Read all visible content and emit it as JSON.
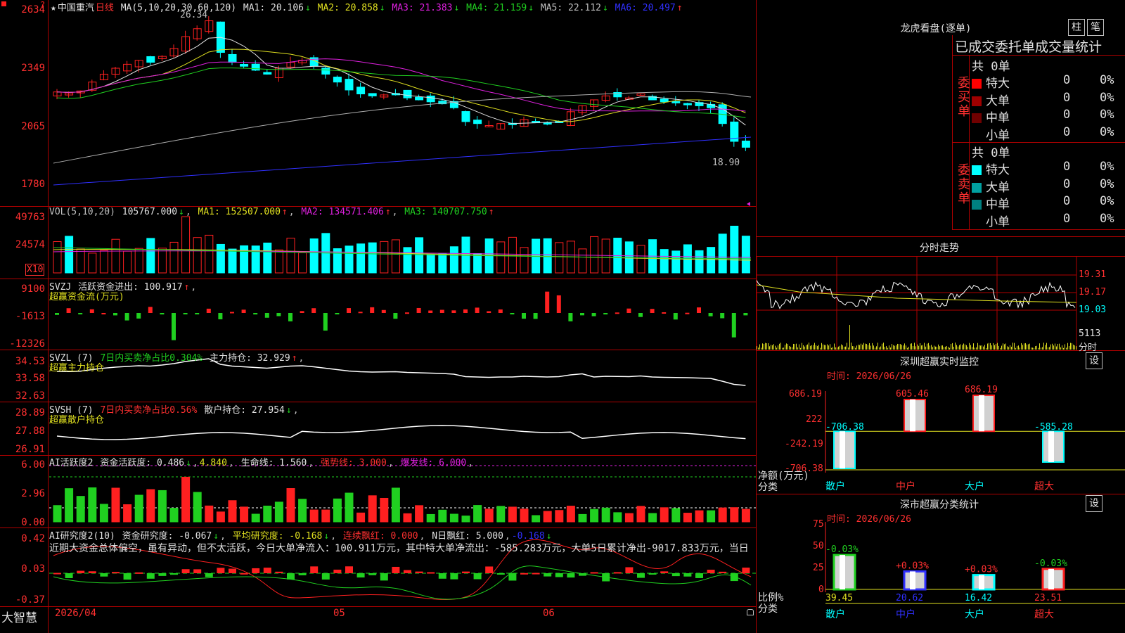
{
  "stock": {
    "star": "★",
    "name": "中国重汽",
    "period": "日线",
    "ma_label": "MA(5,10,20,30,60,120)",
    "ma": [
      {
        "label": "MA1: 20.106",
        "arrow": "↓",
        "color": "#e0e0e0"
      },
      {
        "label": "MA2: 20.858",
        "arrow": "↓",
        "color": "#e0e020"
      },
      {
        "label": "MA3: 21.383",
        "arrow": "↓",
        "color": "#e020e0"
      },
      {
        "label": "MA4: 21.159",
        "arrow": "↓",
        "color": "#20d020"
      },
      {
        "label": "MA5: 22.112",
        "arrow": "↓",
        "color": "#c0c0c0"
      },
      {
        "label": "MA6: 20.497",
        "arrow": "↑",
        "color": "#3030ff"
      }
    ],
    "high_mark": "26.34",
    "low_mark": "18.90",
    "y_labels": [
      "2634",
      "2349",
      "2065",
      "1780"
    ]
  },
  "vol": {
    "title": "VOL(5,10,20)",
    "value": "105767.000",
    "ma1": "MA1: 152507.000",
    "ma2": "MA2: 134571.406",
    "ma3": "MA3: 140707.750",
    "y_labels": [
      "49763",
      "24574"
    ],
    "unit": "X10"
  },
  "svzj": {
    "title": "SVZJ",
    "desc": "活跃资金进出: 100.917",
    "sub": "超赢资金流(万元)",
    "y_labels": [
      "9100",
      "-1613",
      "-12326"
    ]
  },
  "svzl": {
    "title": "SVZL (7)",
    "desc1": "7日内买卖净占比0.304%",
    "desc2": "主力持仓: 32.929",
    "sub": "超赢主力持仓",
    "y_labels": [
      "34.53",
      "33.58",
      "32.63"
    ]
  },
  "svsh": {
    "title": "SVSH (7)",
    "desc1": "7日内买卖净占比0.56%",
    "desc2": "散户持仓: 27.954",
    "sub": "超赢散户持仓",
    "y_labels": [
      "28.89",
      "27.88",
      "26.91"
    ]
  },
  "ai1": {
    "title": "AI活跃度2",
    "f1": "资金活跃度: 0.486",
    "f2": "4.840",
    "f3": "生命线: 1.560",
    "f4": "强势线: 3.000",
    "f5": "爆发线: 6.000",
    "y_labels": [
      "6.00",
      "2.96",
      "0.00"
    ]
  },
  "ai2": {
    "title": "AI研究度2(10)",
    "f1": "资金研究度: -0.067",
    "f2": "平均研究度: -0.168",
    "f3": "连续飘红: 0.000",
    "f4": "N日飘红: 5.000",
    "f5": "-0.168",
    "summary": "近期大资金总体偏空，虽有异动，但不太活跃，今日大单净流入：100.911万元，其中特大单净流出：-585.283万元，大单5日累计净出-9017.833万元，当日",
    "y_labels": [
      "0.42",
      "0.03",
      "-0.37"
    ]
  },
  "axis": {
    "brand": "大智慧",
    "dates": [
      "2026/04",
      "05",
      "06"
    ]
  },
  "dragon": {
    "title": "龙虎看盘(逐单)",
    "btn1": "柱",
    "btn2": "笔",
    "subtitle": "已成交委托单成交量统计",
    "buy_label": "委买单",
    "sell_label": "委卖单",
    "buy_total": "共 0单",
    "sell_total": "共 0单",
    "buy_rows": [
      {
        "name": "特大",
        "val": "0",
        "pct": "0%",
        "color": "#ff0000"
      },
      {
        "name": "大单",
        "val": "0",
        "pct": "0%",
        "color": "#a00000"
      },
      {
        "name": "中单",
        "val": "0",
        "pct": "0%",
        "color": "#700000"
      },
      {
        "name": "小单",
        "val": "0",
        "pct": "0%",
        "color": ""
      }
    ],
    "sell_rows": [
      {
        "name": "特大",
        "val": "0",
        "pct": "0%",
        "color": "#00ffff"
      },
      {
        "name": "大单",
        "val": "0",
        "pct": "0%",
        "color": "#00a0a0"
      },
      {
        "name": "中单",
        "val": "0",
        "pct": "0%",
        "color": "#008080"
      },
      {
        "name": "小单",
        "val": "0",
        "pct": "0%",
        "color": ""
      }
    ]
  },
  "intraday": {
    "title": "分时走势",
    "labels": [
      "19.31",
      "19.17",
      "19.03",
      "5113",
      "分时"
    ]
  },
  "monitor": {
    "title": "深圳超赢实时监控",
    "btn": "设",
    "time": "时间: 2026/06/26",
    "y_labels": [
      "686.19",
      "222",
      "-242.19",
      "-706.38"
    ],
    "ylab_title": "净额(万元)",
    "x_title": "分类",
    "bars": [
      {
        "cat": "散户",
        "value": -706.38,
        "label": "-706.38"
      },
      {
        "cat": "中户",
        "value": 605.46,
        "label": "605.46"
      },
      {
        "cat": "大户",
        "value": 686.19,
        "label": "686.19"
      },
      {
        "cat": "超大",
        "value": -585.28,
        "label": "-585.28"
      }
    ]
  },
  "classify": {
    "title": "深市超赢分类统计",
    "btn": "设",
    "time": "时间: 2026/06/26",
    "y_labels": [
      "75",
      "50",
      "25",
      "0"
    ],
    "ylab_title": "比例%",
    "x_title": "分类",
    "bars": [
      {
        "cat": "散户",
        "value": 39.45,
        "label": "39.45",
        "delta": "-0.03%"
      },
      {
        "cat": "中户",
        "value": 20.62,
        "label": "20.62",
        "delta": "+0.03%"
      },
      {
        "cat": "大户",
        "value": 16.42,
        "label": "16.42",
        "delta": "+0.03%"
      },
      {
        "cat": "超大",
        "value": 23.51,
        "label": "23.51",
        "delta": "-0.03%"
      }
    ]
  },
  "chart_data": [
    {
      "type": "bar",
      "title": "深圳超赢实时监控",
      "categories": [
        "散户",
        "中户",
        "大户",
        "超大"
      ],
      "values": [
        -706.38,
        605.46,
        686.19,
        -585.28
      ],
      "ylabel": "净额(万元)",
      "ylim": [
        -706.38,
        686.19
      ]
    },
    {
      "type": "bar",
      "title": "深市超赢分类统计",
      "categories": [
        "散户",
        "中户",
        "大户",
        "超大"
      ],
      "values": [
        39.45,
        20.62,
        16.42,
        23.51
      ],
      "ylabel": "比例%",
      "ylim": [
        0,
        75
      ]
    }
  ]
}
